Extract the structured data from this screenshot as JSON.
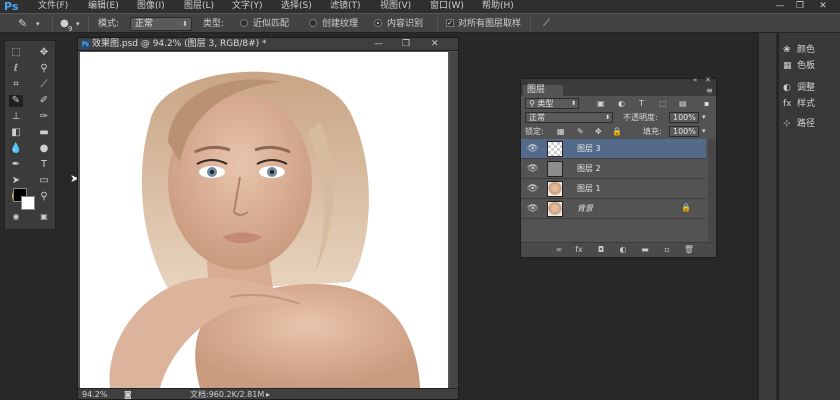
{
  "app": {
    "logo": "Ps"
  },
  "menu": [
    "文件(F)",
    "编辑(E)",
    "图像(I)",
    "图层(L)",
    "文字(Y)",
    "选择(S)",
    "滤镜(T)",
    "视图(V)",
    "窗口(W)",
    "帮助(H)"
  ],
  "window_controls": {
    "minimize": "—",
    "restore": "❐",
    "close": "✕"
  },
  "options": {
    "brush_size": "9",
    "mode_label": "模式:",
    "mode_value": "正常",
    "type_label": "类型:",
    "type_options": [
      "近似匹配",
      "创建纹理",
      "内容识别"
    ],
    "type_selected_index": 2,
    "sample_all_label": "对所有图层取样",
    "sample_all_checked": true
  },
  "document": {
    "title": "效果图.psd @ 94.2% (图层 3, RGB/8#) *",
    "zoom": "94.2%",
    "doc_info": "文档:960.2K/2.81M"
  },
  "layers_panel": {
    "tab": "图层",
    "filter_kind": "类型",
    "blend_mode": "正常",
    "opacity_label": "不透明度:",
    "opacity_value": "100%",
    "lock_label": "锁定:",
    "fill_label": "填充:",
    "fill_value": "100%",
    "layers": [
      {
        "name": "图层 3",
        "selected": true,
        "thumb": "transparent"
      },
      {
        "name": "图层 2",
        "selected": false,
        "thumb": "gray"
      },
      {
        "name": "图层 1",
        "selected": false,
        "thumb": "photo"
      },
      {
        "name": "背景",
        "selected": false,
        "thumb": "photo",
        "locked": true
      }
    ]
  },
  "right_dock": {
    "items": [
      "颜色",
      "色板",
      "调整",
      "样式",
      "路径"
    ]
  },
  "colors": {
    "accent": "#4aa5ef",
    "selected_layer": "#536a8a"
  }
}
